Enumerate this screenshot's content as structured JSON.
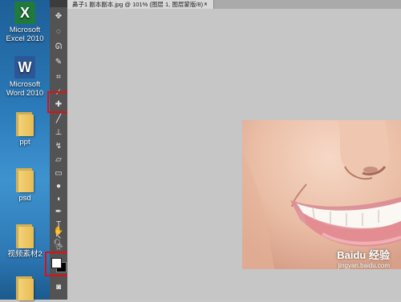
{
  "desktop": {
    "icons": [
      {
        "label1": "Microsoft",
        "label2": "Excel 2010",
        "glyph": "X"
      },
      {
        "label1": "Microsoft",
        "label2": "Word 2010",
        "glyph": "W"
      },
      {
        "label1": "ppt",
        "label2": ""
      },
      {
        "label1": "psd",
        "label2": ""
      },
      {
        "label1": "视频素材2",
        "label2": ""
      }
    ]
  },
  "document": {
    "tab_title": "鼻子1 副本副本.jpg @ 101% (图层 1, 图层蒙版/8) *",
    "close": "×"
  },
  "watermark": {
    "brand": "Baidu 经验",
    "url": "jingyan.baidu.com"
  },
  "colors": {
    "highlight": "#e01010",
    "foreground_swatch": "#ffffff",
    "background_swatch": "#000000",
    "toolbar": "#535353",
    "workspace": "#c6c6c6"
  }
}
